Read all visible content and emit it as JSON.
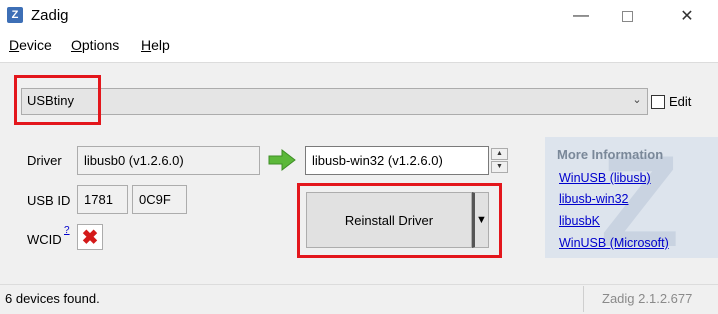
{
  "window": {
    "title": "Zadig",
    "app_icon_glyph": "Z",
    "minimize_glyph": "—",
    "close_glyph": "✕"
  },
  "menu": {
    "device": {
      "mnemonic": "D",
      "rest": "evice"
    },
    "options": {
      "mnemonic": "O",
      "rest": "ptions"
    },
    "help": {
      "mnemonic": "H",
      "rest": "elp"
    }
  },
  "device_select": {
    "value": "USBtiny",
    "arrow_glyph": "⌄"
  },
  "edit": {
    "label": "Edit",
    "checked": false
  },
  "driver": {
    "label": "Driver",
    "current": "libusb0 (v1.2.6.0)",
    "target": "libusb-win32 (v1.2.6.0)"
  },
  "usb_id": {
    "label": "USB ID",
    "vid": "1781",
    "pid": "0C9F"
  },
  "wcid": {
    "label": "WCID",
    "help": "?",
    "status_glyph": "✖"
  },
  "reinstall": {
    "label": "Reinstall Driver",
    "dropdown_glyph": "▼"
  },
  "spinner": {
    "up_glyph": "▲",
    "down_glyph": "▼"
  },
  "info": {
    "title": "More Information",
    "watermark": "Z",
    "links": [
      "WinUSB (libusb)",
      "libusb-win32",
      "libusbK",
      "WinUSB (Microsoft)"
    ]
  },
  "status": {
    "message": "6 devices found.",
    "version": "Zadig 2.1.2.677"
  },
  "colors": {
    "highlight": "#e3161c",
    "link": "#0000cc",
    "arrow": "#5cb83a"
  }
}
